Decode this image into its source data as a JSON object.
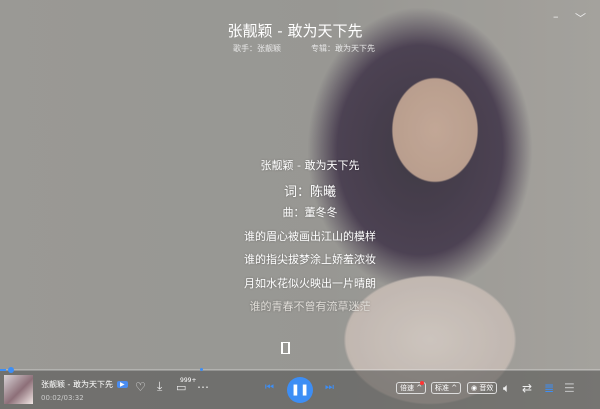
{
  "header": {
    "title": "张靓颖 - 敢为天下先",
    "singer": "歌手：张靓颖",
    "album": "专辑：敢为天下先",
    "minimize": "–",
    "collapse": "﹀"
  },
  "lyrics": [
    "张靓颖 - 敢为天下先",
    "词：陈曦",
    "曲：董冬冬",
    "谁的眉心被画出江山的模样",
    "谁的指尖拔梦涂上娇羞浓妆",
    "月如水花似火映出一片晴朗",
    "谁的青春不曾有流草迷茫"
  ],
  "player": {
    "song": "张靓颖 - 敢为天下先",
    "mv_badge": "▶",
    "time": "00:02/03:32",
    "progress_percent": 1,
    "comment_count": "999+",
    "speed_label": "倍速 ^",
    "quality_label": "标准 ^",
    "effect_label": "◉ 音效"
  },
  "colors": {
    "accent": "#3d8ef5"
  }
}
